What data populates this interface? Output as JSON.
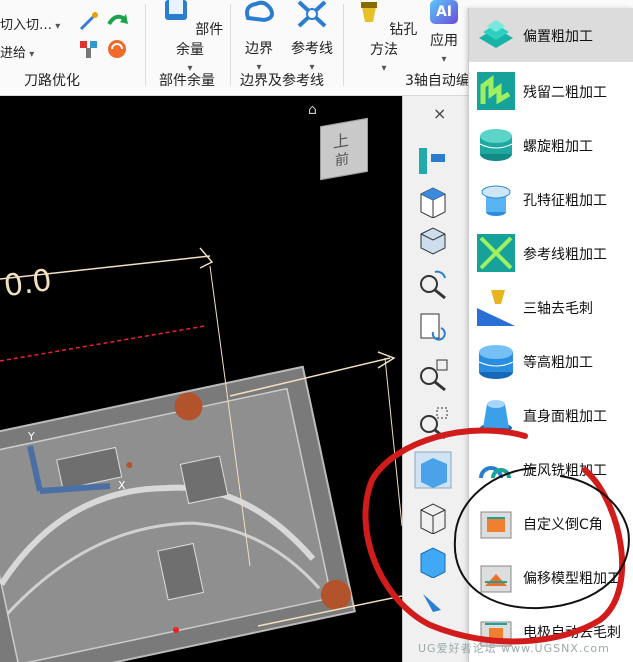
{
  "ribbon": {
    "row_items": [
      "切入切…",
      "进给"
    ],
    "group_toolpath_opt": "刀路优化",
    "parts_remaining_btn": "部件余量",
    "group_parts_remaining": "部件余量",
    "boundary_btn": "边界",
    "refline_btn": "参考线",
    "group_boundary_refline": "边界及参考线",
    "drill_method_btn": "钻孔方法",
    "apply_btn": "应用",
    "group_3axis": "3轴自动编",
    "ai_badge": "AI"
  },
  "dropdown": {
    "items": [
      {
        "label": "偏置粗加工",
        "icon": "offset-rough-icon"
      },
      {
        "label": "残留二粗加工",
        "icon": "rest-rough-icon"
      },
      {
        "label": "螺旋粗加工",
        "icon": "spiral-rough-icon"
      },
      {
        "label": "孔特征粗加工",
        "icon": "hole-feature-icon"
      },
      {
        "label": "参考线粗加工",
        "icon": "refline-rough-icon"
      },
      {
        "label": "三轴去毛刺",
        "icon": "deburr-icon"
      },
      {
        "label": "等高粗加工",
        "icon": "zlevel-rough-icon"
      },
      {
        "label": "直身面粗加工",
        "icon": "straight-wall-icon"
      },
      {
        "label": "旋风铣粗加工",
        "icon": "whirlwind-icon"
      },
      {
        "label": "自定义倒C角",
        "icon": "chamfer-icon"
      },
      {
        "label": "偏移模型粗加工",
        "icon": "offset-model-icon"
      },
      {
        "label": "电极自动去毛刺",
        "icon": "electrode-deburr-icon"
      }
    ]
  },
  "viewport": {
    "dimension_text": "0.0",
    "view_cube_label": "上",
    "view_cube_front": "前",
    "axis_y": "Y",
    "axis_x": "X"
  },
  "toolbar": {
    "close_symbol": "×"
  },
  "watermark": "UG爱好者论坛 www.UGSNX.com",
  "colors": {
    "accent_teal": "#1aa39a",
    "annotation_red": "#d21c1c",
    "highlight": "#dcdcdc"
  }
}
